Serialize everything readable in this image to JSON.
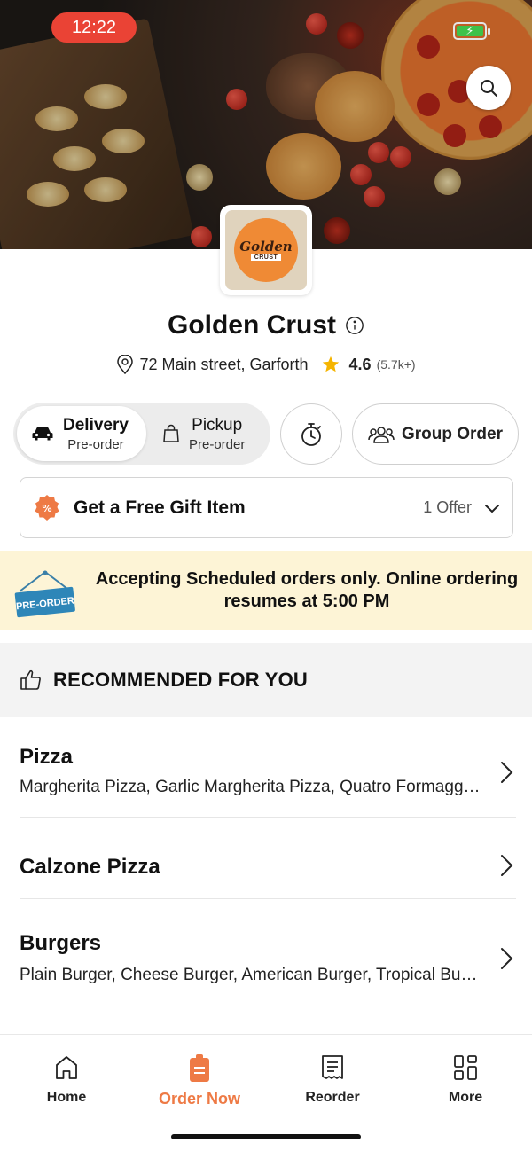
{
  "status_bar": {
    "time": "12:22"
  },
  "header": {
    "search_icon": "search-icon"
  },
  "store": {
    "logo_line1": "Golden",
    "logo_line2": "CRUST",
    "name": "Golden Crust",
    "address": "72 Main street, Garforth",
    "rating": "4.6",
    "rating_count": "(5.7k+)"
  },
  "order_mode": {
    "delivery_label": "Delivery",
    "delivery_sub": "Pre-order",
    "pickup_label": "Pickup",
    "pickup_sub": "Pre-order",
    "group_order_label": "Group Order"
  },
  "offer": {
    "title": "Get a Free Gift Item",
    "count": "1 Offer"
  },
  "banner": {
    "tag": "PRE-ORDER",
    "message": "Accepting Scheduled orders only. Online ordering resumes at 5:00 PM"
  },
  "recommended": {
    "label": "RECOMMENDED FOR YOU"
  },
  "categories": [
    {
      "name": "Pizza",
      "items": "Margherita Pizza, Garlic Margherita Pizza, Quatro Formaggi Pizza"
    },
    {
      "name": "Calzone Pizza",
      "items": ""
    },
    {
      "name": "Burgers",
      "items": "Plain Burger, Cheese Burger, American Burger, Tropical Burger"
    }
  ],
  "bottom_nav": [
    {
      "label": "Home",
      "icon": "home-icon"
    },
    {
      "label": "Order Now",
      "icon": "order-icon"
    },
    {
      "label": "Reorder",
      "icon": "receipt-icon"
    },
    {
      "label": "More",
      "icon": "grid-icon"
    }
  ],
  "colors": {
    "accent": "#ee7a45",
    "status_pill": "#ea4335",
    "banner_bg": "#fdf4d6",
    "rating_star": "#f5b400"
  }
}
